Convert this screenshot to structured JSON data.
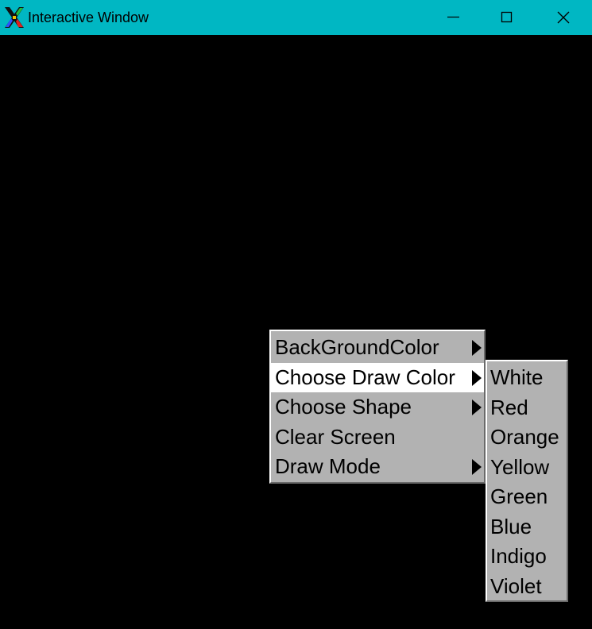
{
  "window": {
    "title": "Interactive Window",
    "app_icon": "x-logo-icon",
    "titlebar_color": "#00b7c3",
    "buttons": {
      "minimize": "minimize-icon",
      "maximize": "maximize-icon",
      "close": "close-icon"
    }
  },
  "canvas": {
    "background": "#000000"
  },
  "context_menu": {
    "items": [
      {
        "label": "BackGroundColor",
        "has_submenu": true,
        "selected": false
      },
      {
        "label": "Choose Draw Color",
        "has_submenu": true,
        "selected": true
      },
      {
        "label": "Choose Shape",
        "has_submenu": true,
        "selected": false
      },
      {
        "label": "Clear Screen",
        "has_submenu": false,
        "selected": false
      },
      {
        "label": "Draw Mode",
        "has_submenu": true,
        "selected": false
      }
    ]
  },
  "submenu": {
    "parent": "Choose Draw Color",
    "items": [
      {
        "label": "White"
      },
      {
        "label": "Red"
      },
      {
        "label": "Orange"
      },
      {
        "label": "Yellow"
      },
      {
        "label": "Green"
      },
      {
        "label": "Blue"
      },
      {
        "label": "Indigo"
      },
      {
        "label": "Violet"
      }
    ]
  }
}
